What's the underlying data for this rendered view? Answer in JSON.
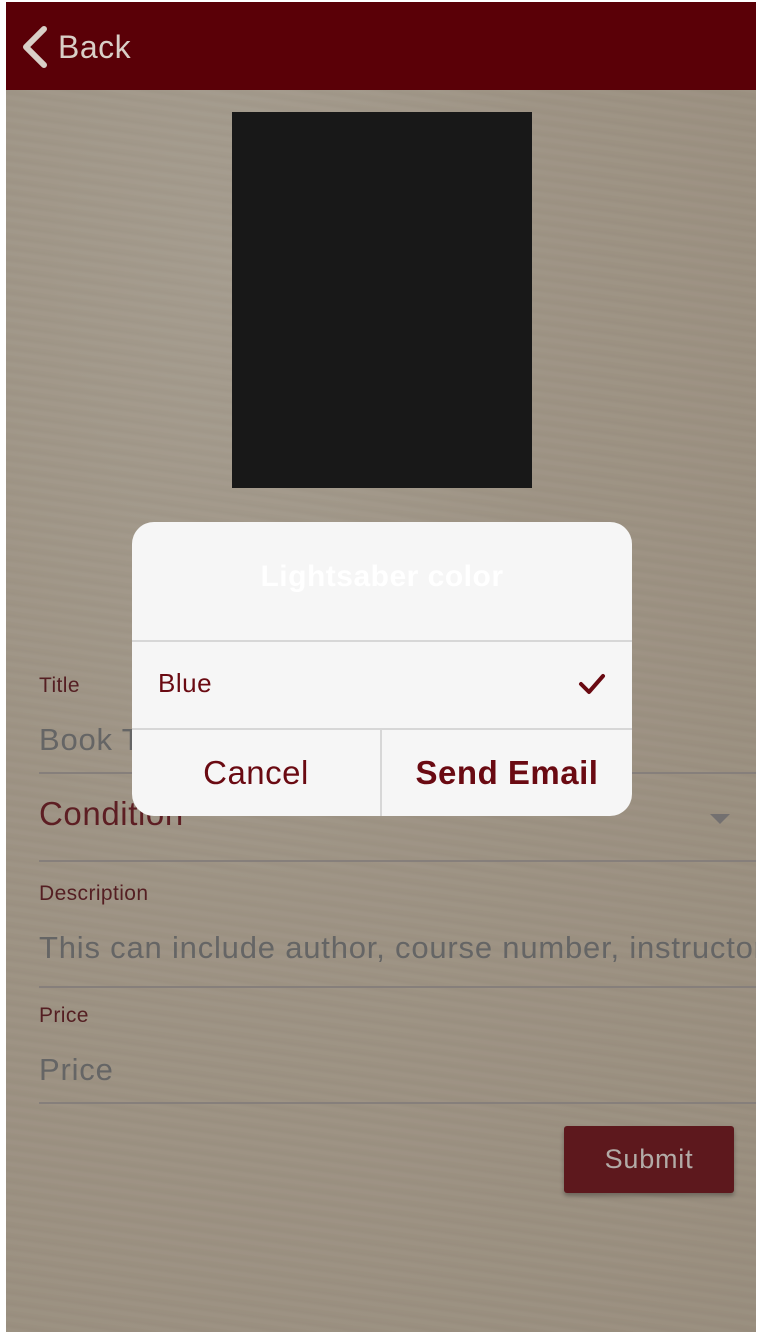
{
  "header": {
    "back_label": "Back"
  },
  "form": {
    "title_label": "Title",
    "title_placeholder": "Book Title",
    "condition_placeholder": "Condition",
    "description_label": "Description",
    "description_placeholder": "This can include author, course number, instructor",
    "price_label": "Price",
    "price_placeholder": "Price",
    "submit_label": "Submit"
  },
  "dialog": {
    "title": "Lightsaber color",
    "options": [
      {
        "label": "Blue",
        "selected": true
      }
    ],
    "cancel_label": "Cancel",
    "confirm_label": "Send Email"
  },
  "icons": {
    "back": "chevron-left-icon",
    "selected": "checkmark-icon",
    "dropdown": "caret-down-icon"
  },
  "colors": {
    "header_bg": "#5a0007",
    "accent": "#6a0a12",
    "submit_bg": "#6a0008",
    "dialog_bg": "#f6f6f6"
  }
}
